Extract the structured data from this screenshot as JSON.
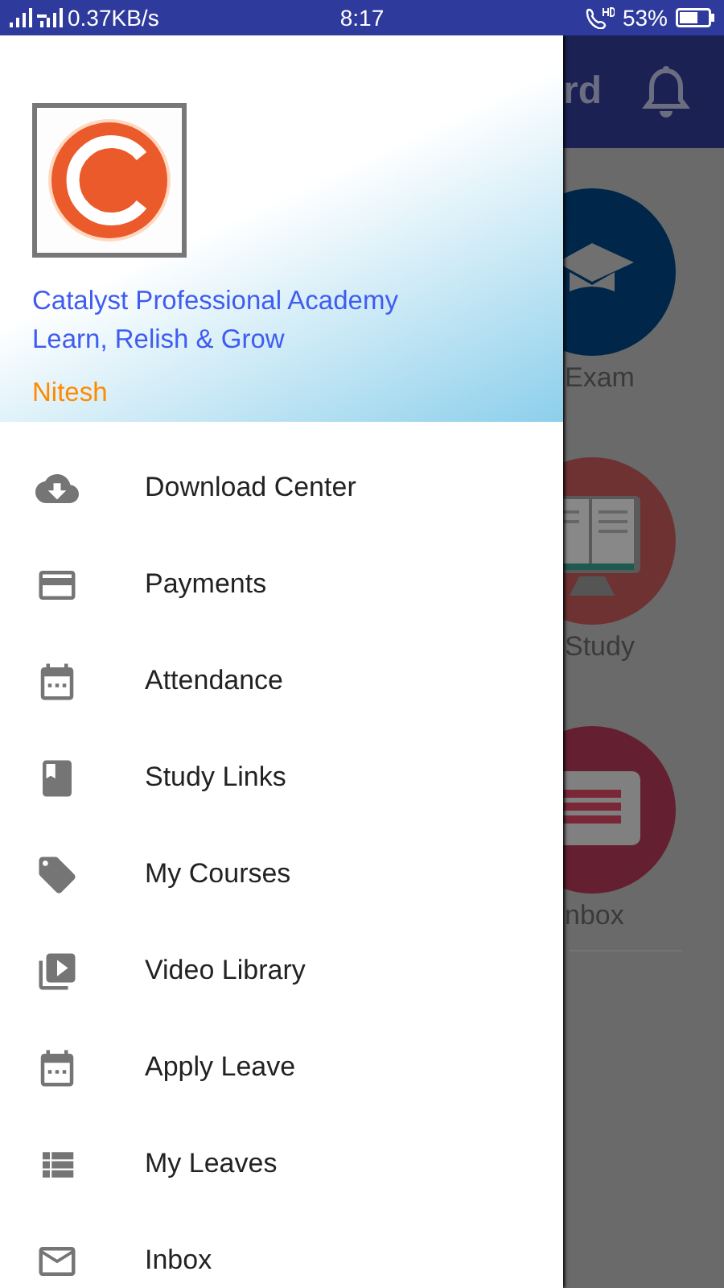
{
  "status_bar": {
    "speed": "0.37KB/s",
    "time": "8:17",
    "battery": "53%"
  },
  "background": {
    "title": "rd",
    "tiles": [
      {
        "kind": "exam",
        "label": "Exam"
      },
      {
        "kind": "study",
        "label": "Study"
      },
      {
        "kind": "inbox",
        "label": "nbox"
      }
    ]
  },
  "drawer": {
    "header": {
      "academy": "Catalyst Professional Academy",
      "tagline": "Learn, Relish & Grow",
      "user": "Nitesh"
    },
    "items": [
      {
        "kind": "download",
        "label": "Download Center"
      },
      {
        "kind": "payment",
        "label": "Payments"
      },
      {
        "kind": "calendar",
        "label": "Attendance"
      },
      {
        "kind": "book",
        "label": "Study Links"
      },
      {
        "kind": "tag",
        "label": "My Courses"
      },
      {
        "kind": "video",
        "label": "Video Library"
      },
      {
        "kind": "calendar",
        "label": "Apply Leave"
      },
      {
        "kind": "list",
        "label": "My Leaves"
      },
      {
        "kind": "mail",
        "label": "Inbox"
      }
    ]
  }
}
